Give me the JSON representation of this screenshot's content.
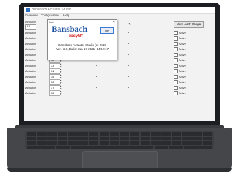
{
  "app": {
    "title": "Bansbach Actuator Studio",
    "menu": [
      "Overview",
      "Configuration",
      "Help"
    ]
  },
  "toolbar": {
    "address_label": "Actuator",
    "address_value": "21",
    "auto_button": "Auto Addr Range"
  },
  "rows": [
    {
      "label": "Actuator",
      "num": "",
      "active": "Active"
    },
    {
      "label": "Actuator",
      "num": "",
      "active": "Active"
    },
    {
      "label": "Actuator",
      "num": "",
      "active": "Active"
    },
    {
      "label": "Actuator",
      "num": "",
      "active": "Active"
    },
    {
      "label": "Actuator",
      "num": "",
      "active": "Active"
    },
    {
      "label": "Actuator",
      "num": "32",
      "active": "Active"
    },
    {
      "label": "Actuator",
      "num": "33",
      "active": "Active"
    },
    {
      "label": "Actuator",
      "num": "34",
      "active": "Active"
    },
    {
      "label": "Actuator",
      "num": "35",
      "active": "Active"
    },
    {
      "label": "Actuator",
      "num": "36",
      "active": "Active"
    },
    {
      "label": "Actuator",
      "num": "37",
      "active": "Active"
    },
    {
      "label": "Actuator",
      "num": "38",
      "active": "Active"
    }
  ],
  "dialog": {
    "title": "Info",
    "close": "×",
    "logo_main": "Bansbach",
    "logo_sub": "easylift",
    "ok": "OK",
    "line1": "Bansbach Actuator Studio (c) 2020",
    "line2": "Ver.: 2.0, Build: Jan 17 2021, 14:54:17"
  },
  "colors": {
    "brand_blue": "#1c4f9c",
    "brand_red": "#d42a2a"
  }
}
